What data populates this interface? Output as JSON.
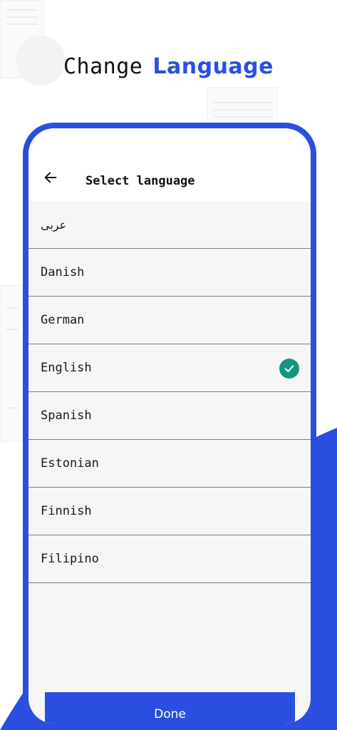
{
  "headline": {
    "word1": "Change",
    "word2": "Language"
  },
  "screen": {
    "title": "Select language",
    "back_icon": "arrow-left-icon",
    "languages": [
      {
        "label": "عربی",
        "selected": false
      },
      {
        "label": "Danish",
        "selected": false
      },
      {
        "label": "German",
        "selected": false
      },
      {
        "label": "English",
        "selected": true
      },
      {
        "label": "Spanish",
        "selected": false
      },
      {
        "label": "Estonian",
        "selected": false
      },
      {
        "label": "Finnish",
        "selected": false
      },
      {
        "label": "Filipino",
        "selected": false
      }
    ],
    "check_icon": "check-circle-icon",
    "done_label": "Done"
  },
  "colors": {
    "accent": "#2a4fe0",
    "check": "#14967f",
    "list_bg": "#f6f6f6"
  }
}
